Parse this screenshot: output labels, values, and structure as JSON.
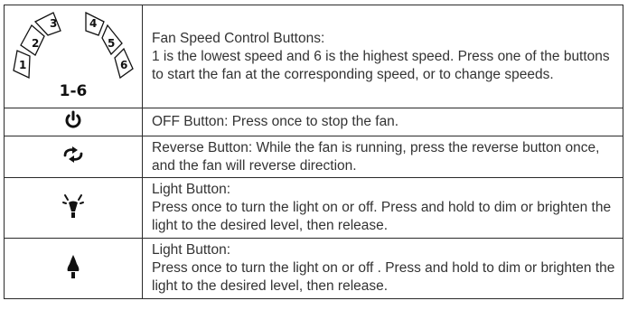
{
  "heading": "",
  "rows": [
    {
      "icon": "fan-speed-keypad-icon",
      "keys": [
        "1",
        "2",
        "3",
        "4",
        "5",
        "6"
      ],
      "icon_label": "1-6",
      "title": "Fan Speed Control Buttons:",
      "body": "1 is the lowest speed and 6 is the highest speed. Press one of the buttons to start the fan at the corresponding speed, or to change speeds."
    },
    {
      "icon": "power-icon",
      "title": "OFF Button: Press once to stop the fan.",
      "body": ""
    },
    {
      "icon": "reverse-arrows-icon",
      "title": "Reverse Button: While the fan is running, press the reverse button once, and the fan will reverse direction.",
      "body": ""
    },
    {
      "icon": "light-bulb-on-icon",
      "title": "Light Button:",
      "body": "Press once to turn the light on or off. Press and hold to dim or brighten the light to the desired level, then release."
    },
    {
      "icon": "light-bulb-icon",
      "title": "Light Button:",
      "body": "Press once to turn the light on or off . Press and hold to dim or brighten the light to the desired level, then release."
    }
  ]
}
